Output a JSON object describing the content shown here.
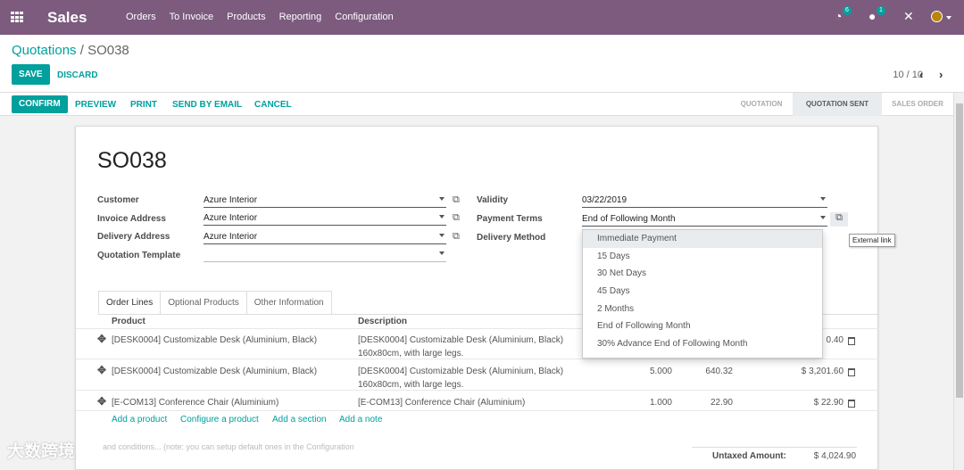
{
  "app": {
    "brand": "Sales",
    "menu": [
      "Orders",
      "To Invoice",
      "Products",
      "Reporting",
      "Configuration"
    ],
    "activity_count": "6",
    "message_count": "1"
  },
  "breadcrumb": {
    "parent": "Quotations",
    "separator": " / ",
    "current": "SO038"
  },
  "buttons": {
    "save": "SAVE",
    "discard": "DISCARD",
    "confirm": "CONFIRM",
    "preview": "PREVIEW",
    "print": "PRINT",
    "send_email": "SEND BY EMAIL",
    "cancel": "CANCEL"
  },
  "pager": "10 / 10",
  "stages": [
    "QUOTATION",
    "QUOTATION SENT",
    "SALES ORDER"
  ],
  "active_stage": "QUOTATION SENT",
  "form": {
    "title": "SO038",
    "customer_label": "Customer",
    "customer": "Azure Interior",
    "invoice_label": "Invoice Address",
    "invoice": "Azure Interior",
    "delivery_label": "Delivery Address",
    "delivery": "Azure Interior",
    "template_label": "Quotation Template",
    "template": "",
    "validity_label": "Validity",
    "validity": "03/22/2019",
    "terms_label": "Payment Terms",
    "terms": "End of Following Month",
    "delivery_method_label": "Delivery Method"
  },
  "tabs": [
    "Order Lines",
    "Optional Products",
    "Other Information"
  ],
  "columns": {
    "product": "Product",
    "description": "Description"
  },
  "lines": [
    {
      "product": "[DESK0004] Customizable Desk (Aluminium, Black)",
      "desc1": "[DESK0004] Customizable Desk (Aluminium, Black)",
      "desc2": "160x80cm, with large legs.",
      "qty": "",
      "price": "",
      "subtotal": "0.40"
    },
    {
      "product": "[DESK0004] Customizable Desk (Aluminium, Black)",
      "desc1": "[DESK0004] Customizable Desk (Aluminium, Black)",
      "desc2": "160x80cm, with large legs.",
      "qty": "5.000",
      "price": "640.32",
      "subtotal": "$ 3,201.60"
    },
    {
      "product": "[E-COM13] Conference Chair (Aluminium)",
      "desc1": "[E-COM13] Conference Chair (Aluminium)",
      "desc2": "",
      "qty": "1.000",
      "price": "22.90",
      "subtotal": "$ 22.90"
    }
  ],
  "add_links": [
    "Add a product",
    "Configure a product",
    "Add a section",
    "Add a note"
  ],
  "notes_placeholder": "and conditions... (note: you can setup default ones in the Configuration",
  "totals": {
    "untaxed_label": "Untaxed Amount:",
    "untaxed": "$ 4,024.90"
  },
  "payment_terms_options": [
    "Immediate Payment",
    "15 Days",
    "30 Net Days",
    "45 Days",
    "2 Months",
    "End of Following Month",
    "30% Advance End of Following Month"
  ],
  "highlighted_option": "Immediate Payment",
  "tooltip": "External link",
  "watermark": "大数跨境",
  "colors": {
    "brand": "#7c5b7f",
    "accent": "#00a09d"
  }
}
